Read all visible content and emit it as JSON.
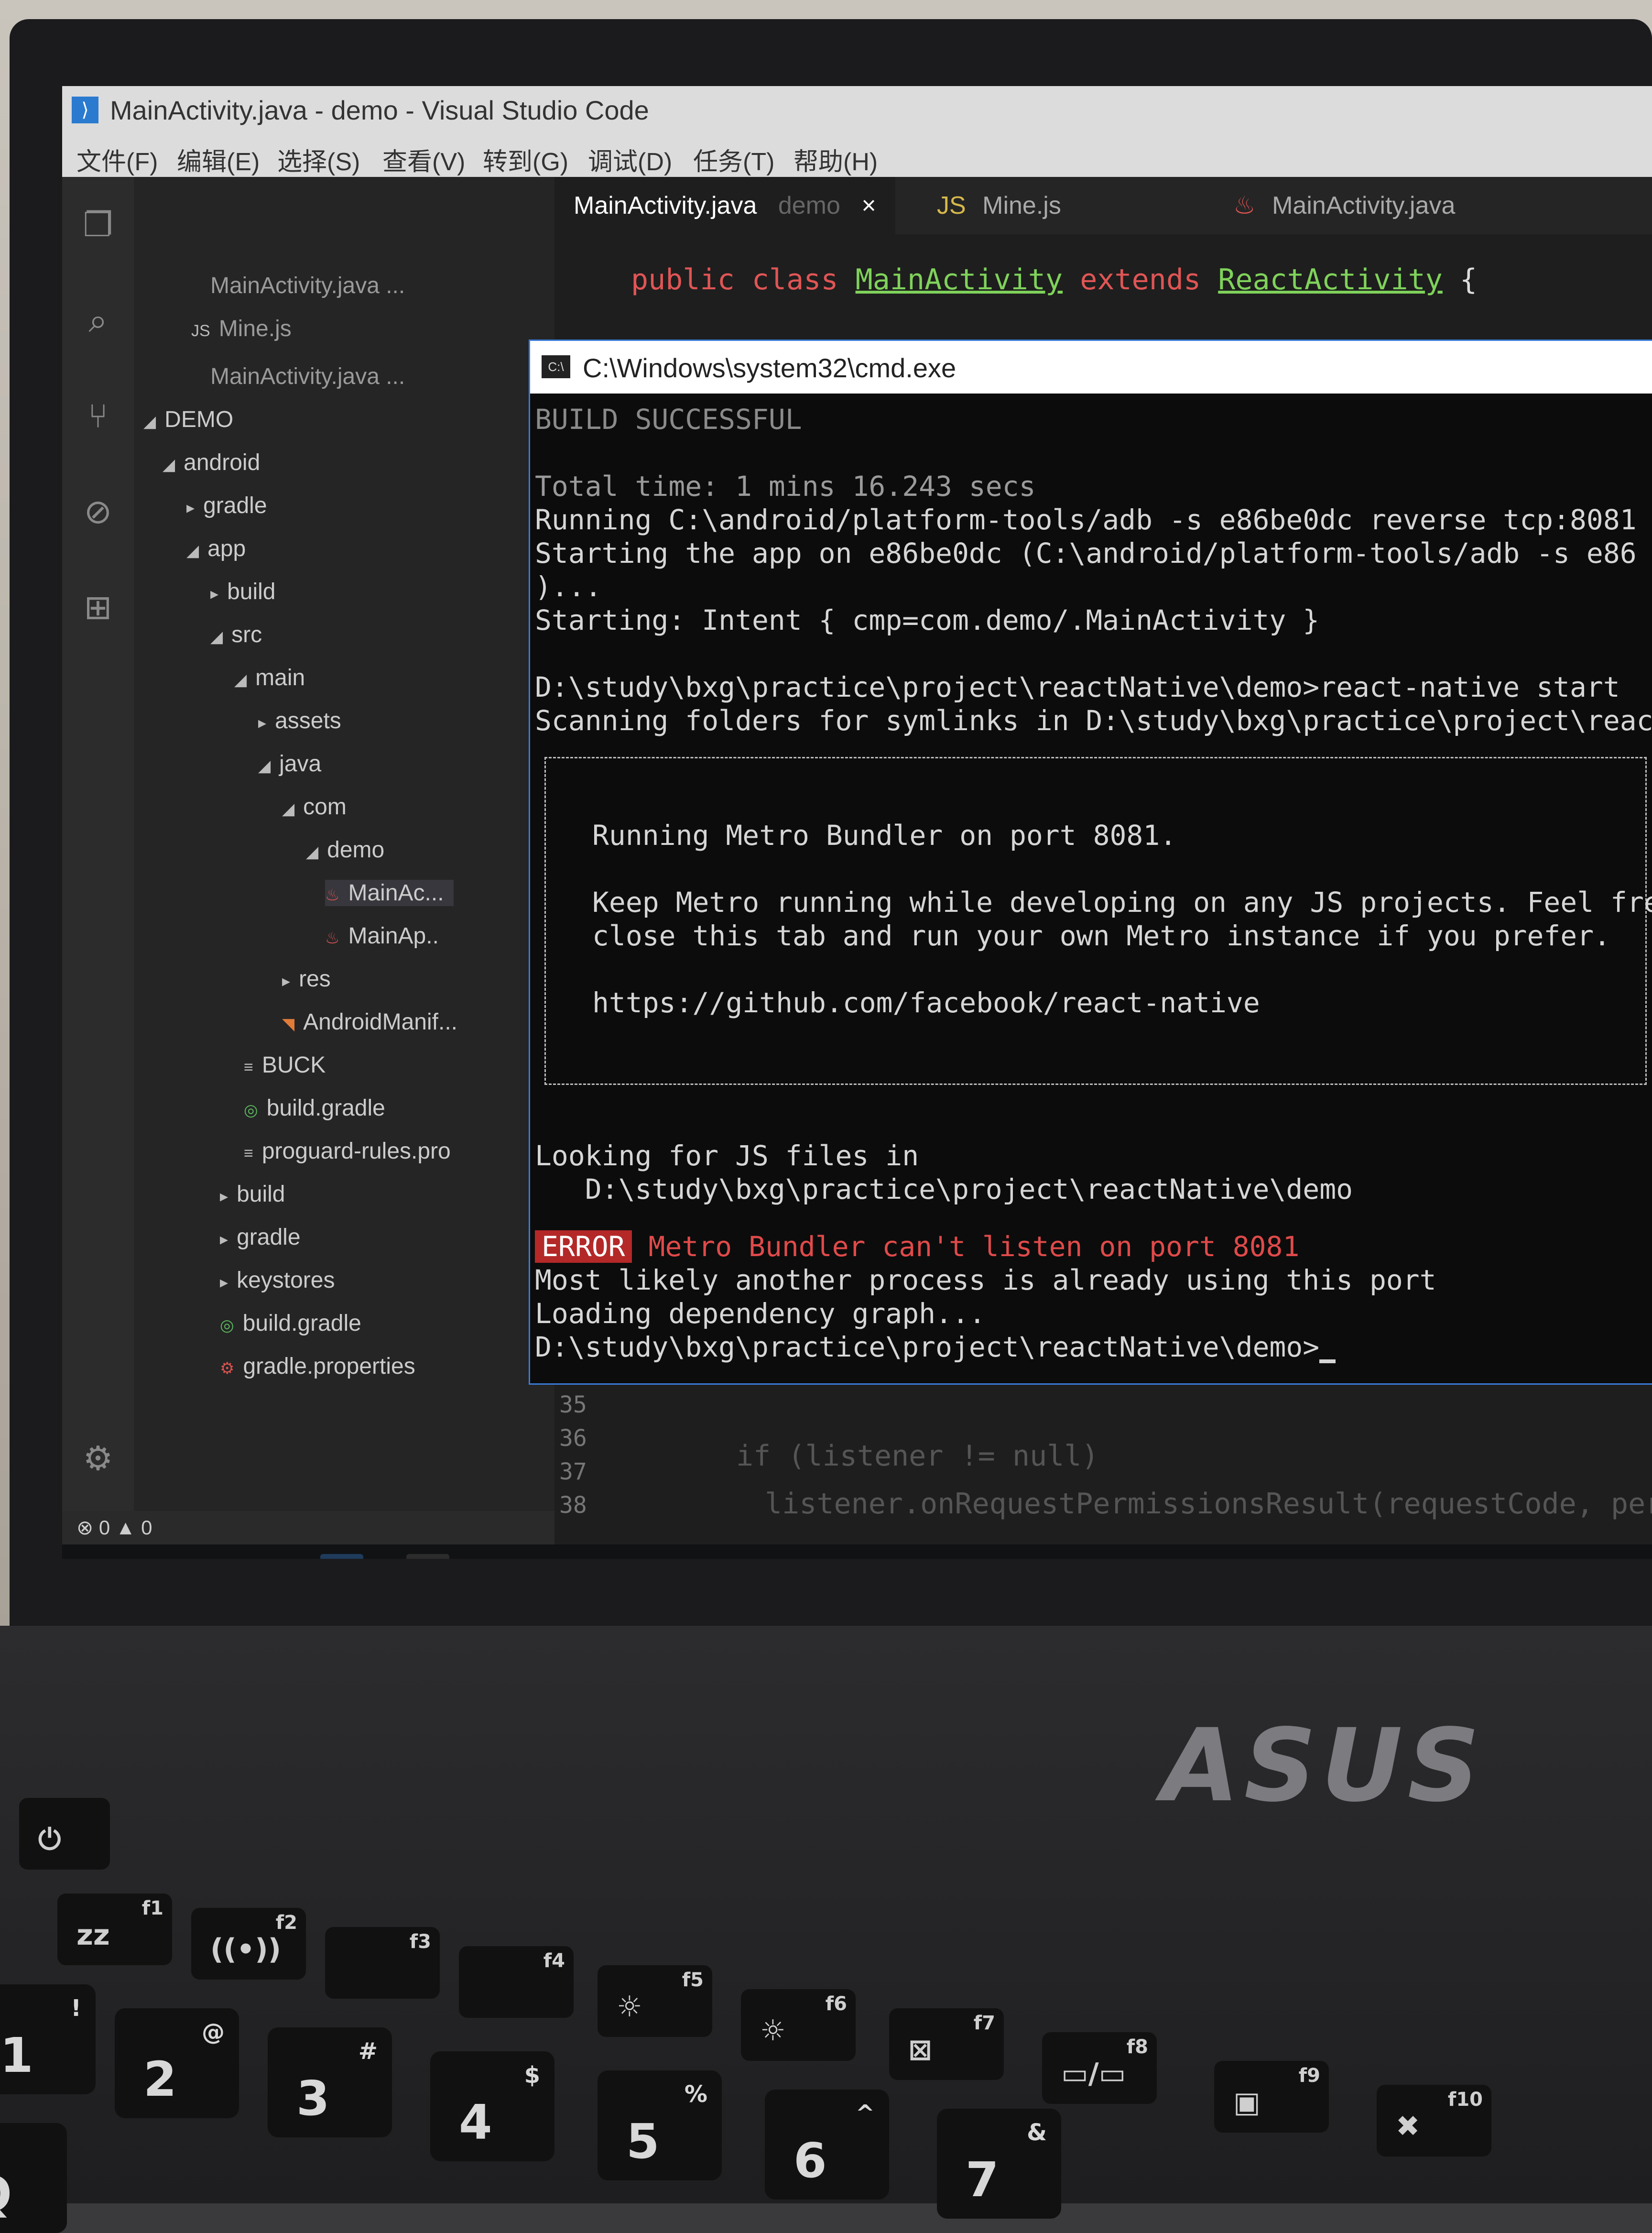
{
  "window": {
    "title": "MainActivity.java - demo - Visual Studio Code"
  },
  "menu": [
    "文件(F)",
    "编辑(E)",
    "选择(S)",
    "查看(V)",
    "转到(G)",
    "调试(D)",
    "任务(T)",
    "帮助(H)"
  ],
  "tabs": [
    {
      "label": "MainActivity.java",
      "dir": "demo",
      "close": "×",
      "active": true
    },
    {
      "label": "Mine.js",
      "prefix": "JS",
      "active": false
    },
    {
      "label": "MainActivity.java",
      "active": false
    }
  ],
  "explorer": {
    "open_editors": [
      "MainActivity.java ...",
      "Mine.js",
      "MainActivity.java ..."
    ],
    "root": "DEMO",
    "tree": [
      "android",
      "gradle",
      "app",
      "build",
      "src",
      "main",
      "assets",
      "java",
      "com",
      "demo",
      "MainAc...",
      "MainAp..",
      "res",
      "AndroidManif...",
      "BUCK",
      "build.gradle",
      "proguard-rules.pro",
      "build",
      "gradle",
      "keystores",
      "build.gradle",
      "gradle.properties"
    ]
  },
  "editor": {
    "line1_kw": "public class",
    "line1_cls": "MainActivity",
    "line1_ext": "extends",
    "line1_sup": "ReactActivity",
    "line1_brace": " {",
    "line_numbers": [
      "35",
      "36",
      "37",
      "38"
    ],
    "faded_code_1": "if (listener != null)",
    "faded_code_2": "listener.onRequestPermissionsResult(requestCode, permissions"
  },
  "cmd": {
    "title": "C:\\Windows\\system32\\cmd.exe",
    "icon_label": "C:\\",
    "lines": [
      "BUILD SUCCESSFUL",
      "Total time: 1 mins 16.243 secs",
      "Running C:\\android/platform-tools/adb -s e86be0dc reverse tcp:8081",
      "Starting the app on e86be0dc (C:\\android/platform-tools/adb -s e86",
      ")...",
      "Starting: Intent { cmp=com.demo/.MainActivity }",
      "D:\\study\\bxg\\practice\\project\\reactNative\\demo>react-native start",
      "Scanning folders for symlinks in D:\\study\\bxg\\practice\\project\\reac"
    ],
    "box_lines": [
      "Running Metro Bundler on port 8081.",
      "Keep Metro running while developing on any JS projects. Feel fre",
      "close this tab and run your own Metro instance if you prefer.",
      "https://github.com/facebook/react-native"
    ],
    "after_lines": [
      "Looking for JS files in",
      "   D:\\study\\bxg\\practice\\project\\reactNative\\demo"
    ],
    "error_tag": "ERROR",
    "error_msg": "Metro Bundler can't listen on port 8081",
    "tail_lines": [
      "Most likely another process is already using this port",
      "Loading dependency graph...",
      "D:\\study\\bxg\\practice\\project\\reactNative\\demo>"
    ]
  },
  "statusbar": {
    "text": "⊗ 0 ▲ 0"
  },
  "brand": "ASUS",
  "keyboard": {
    "fkeys": [
      {
        "main": "zz",
        "sub": "f1"
      },
      {
        "main": "((•))",
        "sub": "f2"
      },
      {
        "main": "",
        "sub": "f3"
      },
      {
        "main": "",
        "sub": "f4"
      },
      {
        "main": "☼",
        "sub": "f5"
      },
      {
        "main": "☼",
        "sub": "f6"
      },
      {
        "main": "⊠",
        "sub": "f7"
      },
      {
        "main": "▭/▭",
        "sub": "f8"
      },
      {
        "main": "▣",
        "sub": "f9"
      },
      {
        "main": "✖",
        "sub": "f10"
      }
    ],
    "keys": [
      {
        "main": "1",
        "sub": "!"
      },
      {
        "main": "2",
        "sub": "@"
      },
      {
        "main": "3",
        "sub": "#"
      },
      {
        "main": "4",
        "sub": "$"
      },
      {
        "main": "5",
        "sub": "%"
      },
      {
        "main": "6",
        "sub": "^"
      },
      {
        "main": "7",
        "sub": "&"
      }
    ],
    "power_label": "⏻",
    "q_label": "Q"
  }
}
